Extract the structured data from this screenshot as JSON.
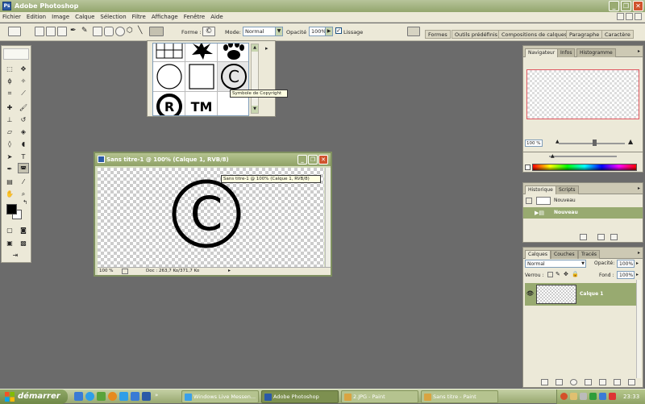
{
  "app": {
    "title": "Adobe Photoshop",
    "logo_text": "Ps"
  },
  "menu": [
    "Fichier",
    "Edition",
    "Image",
    "Calque",
    "Sélection",
    "Filtre",
    "Affichage",
    "Fenêtre",
    "Aide"
  ],
  "options": {
    "forme_label": "Forme :",
    "mode_label": "Mode:",
    "mode_value": "Normal",
    "opacite_label": "Opacité :",
    "opacite_value": "100%",
    "lissage_label": "Lissage",
    "lissage_checked": true,
    "dock_tabs": [
      "Formes",
      "Outils prédéfinis",
      "Compositions de calques",
      "Paragraphe",
      "Caractère"
    ]
  },
  "shape_picker": {
    "tooltip": "Symbole de Copyright"
  },
  "document": {
    "title": "Sans titre-1 @ 100% (Calque 1, RVB/8)",
    "zoom": "100 %",
    "doc_info": "Doc : 263,7 Ko/371,7 Ko",
    "tooltip": "Sans titre-1 @ 100% (Calque 1, RVB/8)",
    "glyph": "©"
  },
  "navigator": {
    "tabs": [
      "Navigateur",
      "Infos",
      "Histogramme"
    ],
    "zoom": "100 %"
  },
  "history": {
    "tabs": [
      "Historique",
      "Scripts"
    ],
    "items": [
      "Nouveau",
      "Nouveau"
    ]
  },
  "layers": {
    "tabs": [
      "Calques",
      "Couches",
      "Tracés"
    ],
    "blend_mode": "Normal",
    "opacity_label": "Opacité:",
    "opacity_value": "100%",
    "lock_label": "Verrou :",
    "fill_label": "Fond :",
    "fill_value": "100%",
    "layer_name": "Calque 1"
  },
  "taskbar": {
    "start_label": "démarrer",
    "tasks": [
      "Windows Live Messen...",
      "Adobe Photoshop",
      "2.JPG - Paint",
      "Sans titre - Paint"
    ],
    "active_task": "Adobe Photoshop",
    "clock": "23:33"
  },
  "colors": {
    "xp_olive": "#98aa70",
    "workspace": "#6b6b6b",
    "nav_frame": "#e0555f"
  }
}
